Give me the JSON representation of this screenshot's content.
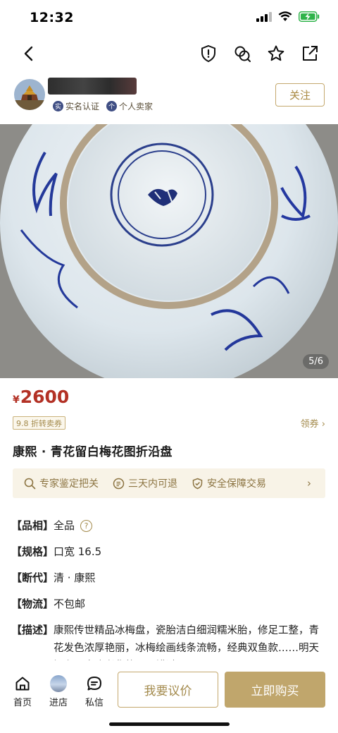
{
  "status_bar": {
    "time": "12:32"
  },
  "seller": {
    "badge_real_name_mark": "实",
    "badge_real_name": "实名认证",
    "badge_personal_mark": "个",
    "badge_personal": "个人卖家",
    "follow_label": "关注"
  },
  "gallery": {
    "counter": "5/6"
  },
  "price": {
    "symbol": "¥",
    "value": "2600"
  },
  "coupon": {
    "tag": "9.8 折转卖券",
    "link": "领券 ›"
  },
  "product": {
    "title": "康熙 · 青花留白梅花图折沿盘"
  },
  "guarantee": {
    "items": [
      "专家鉴定把关",
      "三天内可退",
      "安全保障交易"
    ],
    "chevron": "›"
  },
  "specs": {
    "condition_key": "【品相】",
    "condition_val": "全品",
    "condition_help": "?",
    "size_key": "【规格】",
    "size_val": "口宽 16.5",
    "era_key": "【断代】",
    "era_val": "清 · 康熙",
    "shipping_key": "【物流】",
    "shipping_val": "不包邮",
    "desc_key": "【描述】",
    "desc_val": "康熙传世精品冰梅盘，瓷胎洁白细润糯米胎，修足工整，青花发色浓厚艳丽，冰梅绘画线条流畅，经典双鱼款……明天门有，喜欢者货的不要错过!"
  },
  "bottom_bar": {
    "tab_home": "首页",
    "tab_shop": "进店",
    "tab_messages": "私信",
    "offer_label": "我要议价",
    "buy_label": "立即购买"
  },
  "colors": {
    "accent_gold": "#c0a66c",
    "price_red": "#b33226",
    "bar_tint": "#f8f3e7"
  }
}
